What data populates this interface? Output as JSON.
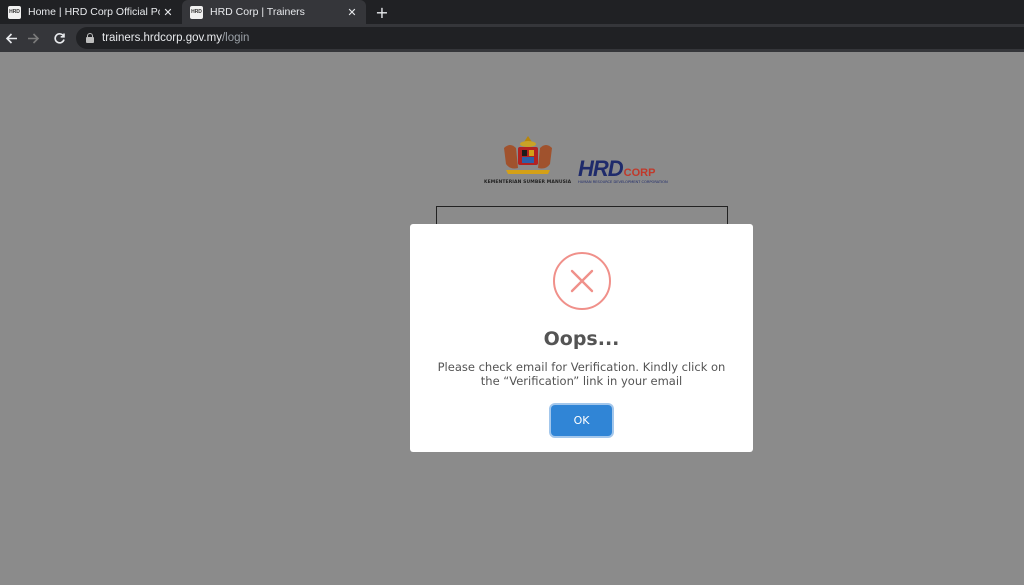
{
  "browser": {
    "tabs": [
      {
        "favicon": "HRD",
        "title": "Home | HRD Corp Official Portal",
        "close": "✕"
      },
      {
        "favicon": "HRD",
        "title": "HRD Corp | Trainers",
        "close": "✕"
      }
    ],
    "new_tab": "+",
    "url_host": "trainers.hrdcorp.gov.my",
    "url_path": "/login"
  },
  "page": {
    "ministry_text": "KEMENTERIAN SUMBER MANUSIA",
    "brand_main": "HRD",
    "brand_corp": "CORP",
    "brand_sub": "HUMAN RESOURCE DEVELOPMENT CORPORATION"
  },
  "modal": {
    "icon": "error-x-icon",
    "title": "Oops...",
    "message": "Please check email for Verification. Kindly click on the “Verification” link in your email",
    "ok_label": "OK"
  },
  "colors": {
    "error": "#f0908a",
    "button": "#3085d6",
    "overlay": "#8b8b8b"
  }
}
